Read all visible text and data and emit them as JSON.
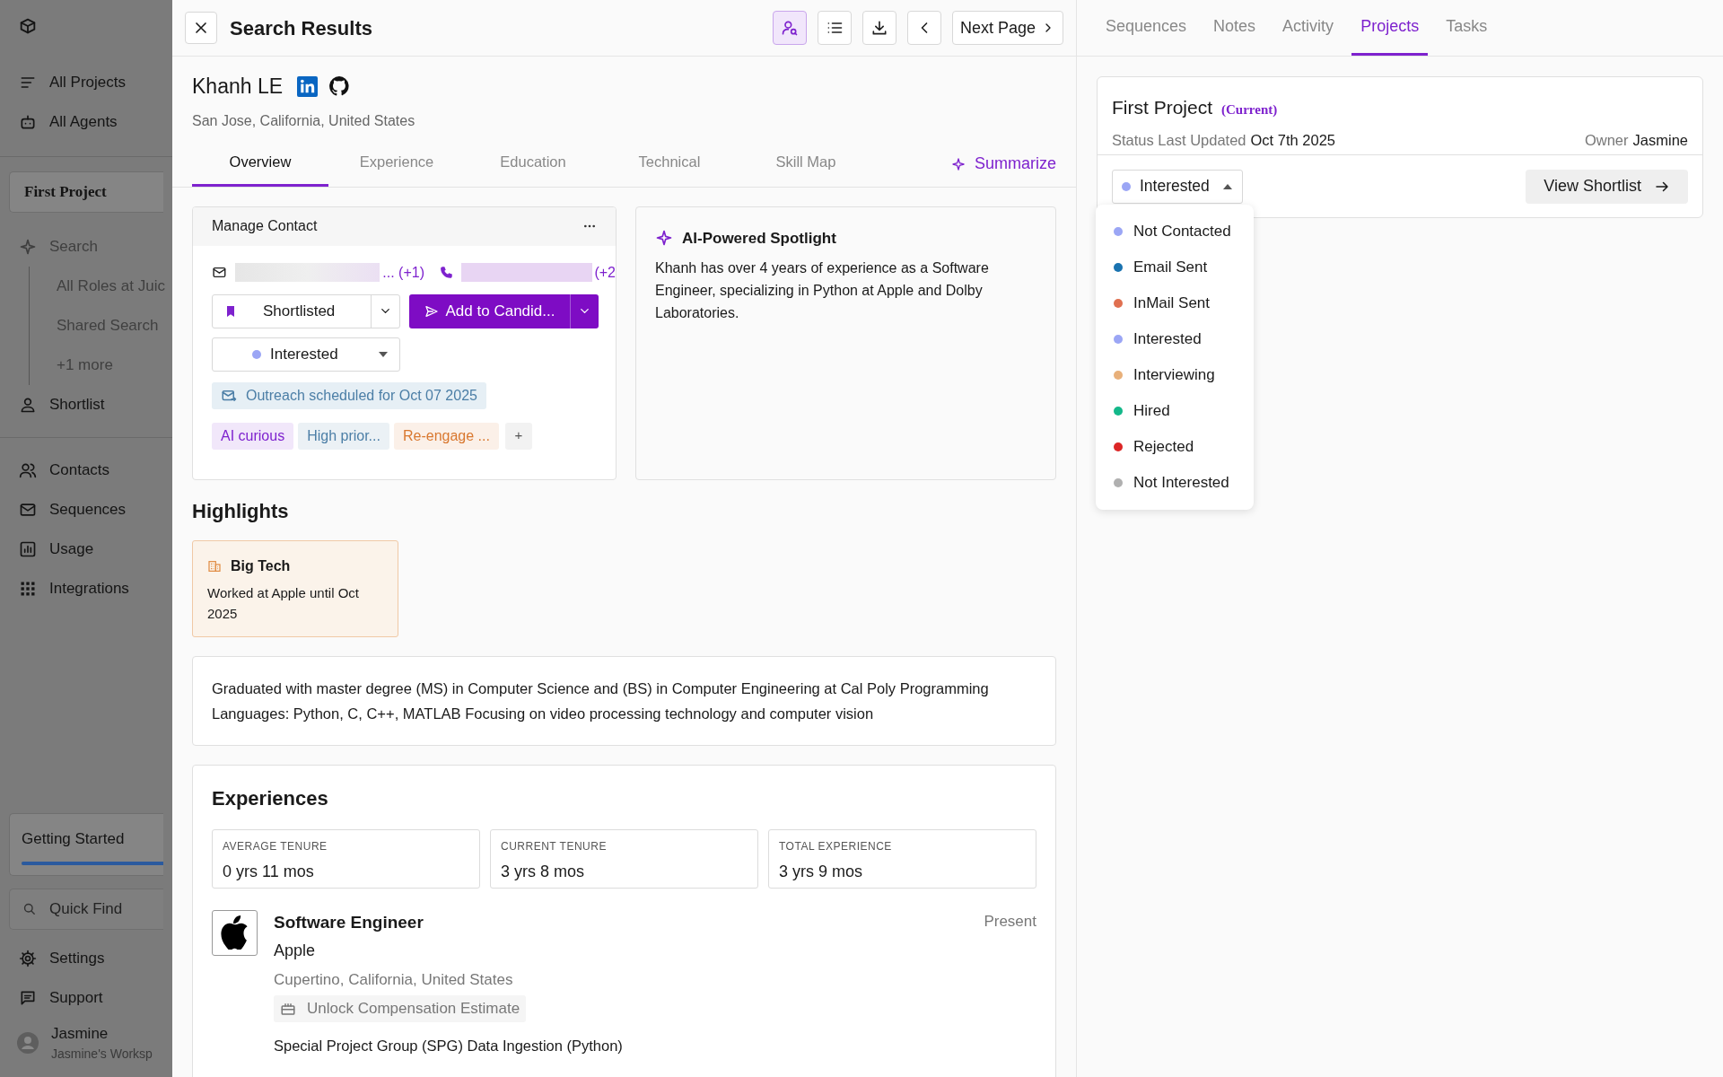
{
  "sidebar": {
    "top_nav": [
      {
        "label": "All Projects"
      },
      {
        "label": "All Agents"
      }
    ],
    "project": {
      "name": "First Project",
      "items": [
        {
          "kind": "search",
          "label": "Search",
          "children": [
            {
              "label": "All Roles at Juic"
            },
            {
              "label": "Shared Search"
            },
            {
              "label": "+1 more"
            }
          ]
        },
        {
          "kind": "link",
          "label": "Shortlist"
        }
      ]
    },
    "nav": [
      {
        "label": "Contacts"
      },
      {
        "label": "Sequences"
      },
      {
        "label": "Usage"
      },
      {
        "label": "Integrations"
      }
    ],
    "getting_started": {
      "label": "Getting Started",
      "level": 1
    },
    "quick_find": {
      "placeholder": "Quick Find"
    },
    "bottom_nav": [
      {
        "label": "Settings"
      },
      {
        "label": "Support"
      }
    ],
    "user": {
      "name": "Jasmine",
      "workspace": "Jasmine's Worksp"
    }
  },
  "header": {
    "title": "Search Results",
    "toolbar": [
      {
        "selected": true
      },
      {
        "selected": false
      },
      {
        "selected": false
      },
      {
        "selected": false
      }
    ],
    "next_page": "Next Page"
  },
  "profile": {
    "name": "Khanh LE",
    "location": "San Jose, California, United States"
  },
  "profile_tabs": [
    {
      "label": "Overview",
      "selected": true
    },
    {
      "label": "Experience",
      "selected": false
    },
    {
      "label": "Education",
      "selected": false
    },
    {
      "label": "Technical",
      "selected": false
    },
    {
      "label": "Skill Map",
      "selected": false
    }
  ],
  "summarize": "Summarize",
  "manage_contact": {
    "title": "Manage Contact",
    "email_more": "... (+1)",
    "phone_more": "(+2",
    "shortlist": "Shortlisted",
    "add_button": "Add to Candid...",
    "status": {
      "label": "Interested",
      "color": "#9ba6f5"
    },
    "outreach": "Outreach scheduled for Oct 07 2025",
    "tags": [
      {
        "label": "AI curious",
        "color": "#7e22ce"
      },
      {
        "label": "High prior...",
        "color": "#4b7ea6"
      },
      {
        "label": "Re-engage ...",
        "color": "#d9782f"
      }
    ],
    "add_tag": "+"
  },
  "spotlight": {
    "title": "AI-Powered Spotlight",
    "text": "Khanh has over 4 years of experience as a Software Engineer, specializing in Python at Apple and Dolby Laboratories."
  },
  "highlights": {
    "title": "Highlights",
    "cards": [
      {
        "title": "Big Tech",
        "text": "Worked at Apple until Oct 2025"
      }
    ]
  },
  "education_summary": "Graduated with master degree (MS) in Computer Science and (BS) in Computer Engineering at Cal Poly Programming Languages: Python, C, C++, MATLAB Focusing on video processing technology and computer vision",
  "experiences": {
    "title": "Experiences",
    "stats": [
      {
        "label": "AVERAGE TENURE",
        "value": "0 yrs 11 mos"
      },
      {
        "label": "CURRENT TENURE",
        "value": "3 yrs 8 mos"
      },
      {
        "label": "TOTAL EXPERIENCE",
        "value": "3 yrs 9 mos"
      }
    ],
    "items": [
      {
        "title": "Software Engineer",
        "company": "Apple",
        "location": "Cupertino, California, United States",
        "unlock": "Unlock Compensation Estimate",
        "date": "Present",
        "description": "Special Project Group (SPG) Data Ingestion (Python)"
      }
    ]
  },
  "right_tabs": [
    {
      "label": "Sequences",
      "selected": false
    },
    {
      "label": "Notes",
      "selected": false
    },
    {
      "label": "Activity",
      "selected": false
    },
    {
      "label": "Projects",
      "selected": true
    },
    {
      "label": "Tasks",
      "selected": false
    }
  ],
  "project_card": {
    "name": "First Project",
    "current": "(Current)",
    "status_label": "Status Last Updated",
    "status_date": "Oct 7th 2025",
    "owner_label": "Owner",
    "owner": "Jasmine",
    "status": {
      "label": "Interested",
      "color": "#9ba6f5",
      "expanded": true
    },
    "view_shortlist": "View Shortlist"
  },
  "status_options": [
    {
      "label": "Not Contacted",
      "color": "#9ba6f5"
    },
    {
      "label": "Email Sent",
      "color": "#1a73b0"
    },
    {
      "label": "InMail Sent",
      "color": "#e07050"
    },
    {
      "label": "Interested",
      "color": "#9ba6f5"
    },
    {
      "label": "Interviewing",
      "color": "#e8b07a"
    },
    {
      "label": "Hired",
      "color": "#14b88a"
    },
    {
      "label": "Rejected",
      "color": "#dc2626"
    },
    {
      "label": "Not Interested",
      "color": "#b0b0b0"
    }
  ]
}
